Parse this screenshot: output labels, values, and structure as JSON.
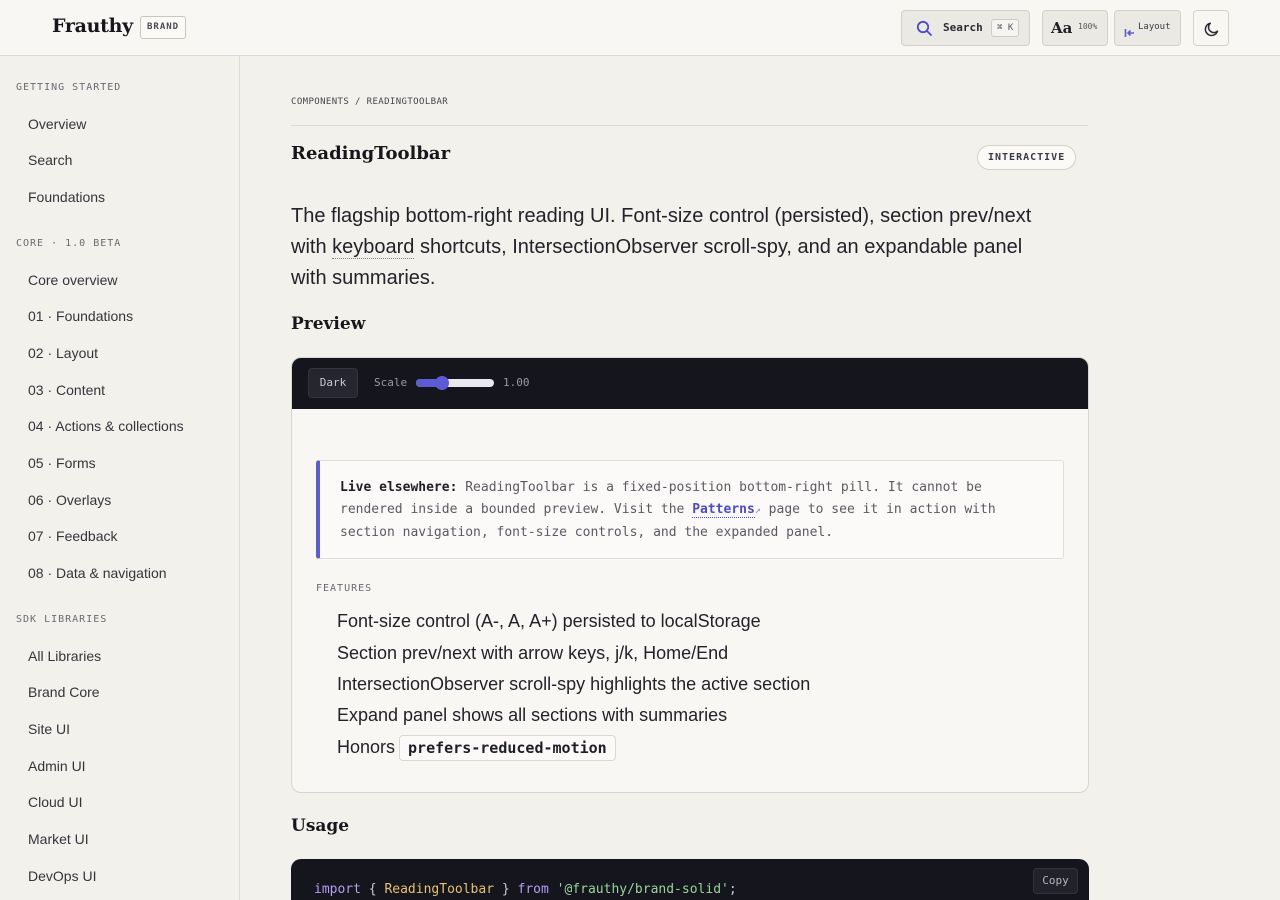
{
  "header": {
    "logo": "Frauthy",
    "badge": "BRAND",
    "search_label": "Search",
    "search_shortcut": "⌘ K",
    "font_button_label": "Aa",
    "font_scale": "100%",
    "layout_label": "Layout"
  },
  "sidebar": {
    "sections": [
      {
        "heading": "GETTING STARTED",
        "items": [
          "Overview",
          "Search",
          "Foundations"
        ]
      },
      {
        "heading": "CORE · 1.0 BETA",
        "items": [
          "Core overview",
          "01 · Foundations",
          "02 · Layout",
          "03 · Content",
          "04 · Actions & collections",
          "05 · Forms",
          "06 · Overlays",
          "07 · Feedback",
          "08 · Data & navigation"
        ]
      },
      {
        "heading": "SDK LIBRARIES",
        "items": [
          "All Libraries",
          "Brand Core",
          "Site UI",
          "Admin UI",
          "Cloud UI",
          "Market UI",
          "DevOps UI"
        ]
      }
    ]
  },
  "main": {
    "breadcrumb": "COMPONENTS / READINGTOOLBAR",
    "title": "ReadingToolbar",
    "status_pill": "INTERACTIVE",
    "lede_before": "The flagship bottom-right reading UI. Font-size control (persisted), section prev/next with ",
    "lede_keyword": "keyboard",
    "lede_after": " shortcuts, IntersectionObserver scroll-spy, and an expandable panel with summaries.",
    "preview_heading": "Preview",
    "usage_heading": "Usage"
  },
  "preview": {
    "dark_button": "Dark",
    "scale_label": "Scale",
    "scale_value": "1.00",
    "scale_fraction": 0.33,
    "callout_bold": "Live elsewhere:",
    "callout_text_1": " ReadingToolbar is a fixed-position bottom-right pill. It cannot be rendered inside a bounded preview. Visit the ",
    "callout_link": "Patterns",
    "callout_link_icon": "↗",
    "callout_text_2": " page to see it in action with section navigation, font-size controls, and the expanded panel.",
    "features_heading": "FEATURES",
    "features": [
      "Font-size control (A-, A, A+) persisted to localStorage",
      "Section prev/next with arrow keys, j/k, Home/End",
      "IntersectionObserver scroll-spy highlights the active section",
      "Expand panel shows all sections with summaries",
      "Honors"
    ],
    "features_code": "prefers-reduced-motion"
  },
  "usage": {
    "copy_label": "Copy",
    "code_import": "import",
    "code_open": " { ",
    "code_identifier": "ReadingToolbar",
    "code_close": " } ",
    "code_from": "from",
    "code_space": " ",
    "code_source": "'@frauthy/brand-solid'",
    "code_end": ";"
  },
  "colors": {
    "accent": "#5b5bd6",
    "code_background": "#15151e",
    "page_background": "#f3f1ec"
  },
  "icons": {
    "search": "search-icon",
    "layout": "layout-icon",
    "theme": "moon-icon"
  }
}
